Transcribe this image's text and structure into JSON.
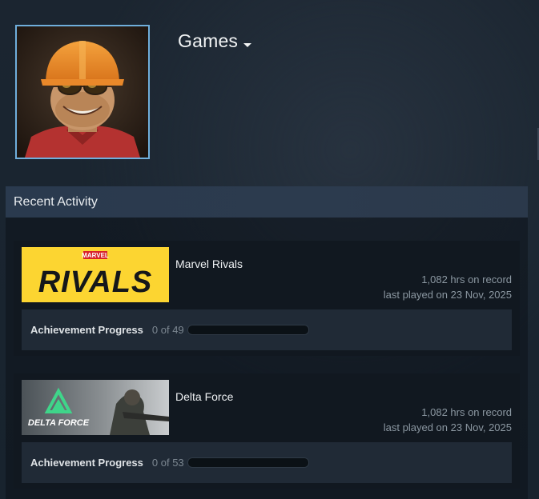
{
  "profile": {
    "games_menu_label": "Games"
  },
  "recent_activity": {
    "header": "Recent Activity",
    "games": [
      {
        "name": "Marvel Rivals",
        "hours": "1,082 hrs on record",
        "last_played": "last played on 23 Nov, 2025",
        "achievement_label": "Achievement Progress",
        "achievement_count": "0 of 49",
        "achievement_progress": 0,
        "logo_top": "MARVEL",
        "logo_main": "RIVALS",
        "banner_color": "#fcd531"
      },
      {
        "name": "Delta Force",
        "hours": "1,082 hrs on record",
        "last_played": "last played on 23 Nov, 2025",
        "achievement_label": "Achievement Progress",
        "achievement_count": "0 of 53",
        "achievement_progress": 0,
        "logo_main": "DELTA FORCE",
        "logo_color": "#3fd58a"
      }
    ]
  }
}
